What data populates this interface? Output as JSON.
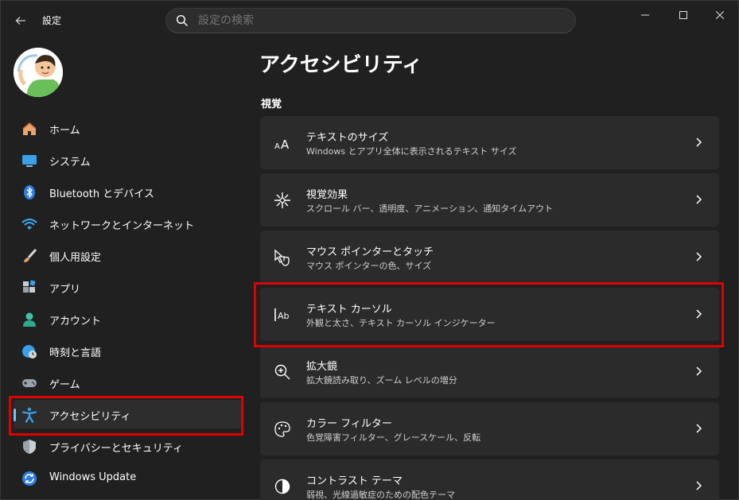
{
  "app": {
    "title": "設定"
  },
  "search": {
    "placeholder": "設定の検索"
  },
  "sidebar": {
    "items": [
      {
        "label": "ホーム",
        "icon": "home-icon"
      },
      {
        "label": "システム",
        "icon": "monitor-icon"
      },
      {
        "label": "Bluetooth とデバイス",
        "icon": "bluetooth-icon"
      },
      {
        "label": "ネットワークとインターネット",
        "icon": "wifi-icon"
      },
      {
        "label": "個人用設定",
        "icon": "brush-icon"
      },
      {
        "label": "アプリ",
        "icon": "apps-icon"
      },
      {
        "label": "アカウント",
        "icon": "person-icon"
      },
      {
        "label": "時刻と言語",
        "icon": "clock-globe-icon"
      },
      {
        "label": "ゲーム",
        "icon": "gamepad-icon"
      },
      {
        "label": "アクセシビリティ",
        "icon": "accessibility-icon",
        "active": true
      },
      {
        "label": "プライバシーとセキュリティ",
        "icon": "shield-icon"
      },
      {
        "label": "Windows Update",
        "icon": "update-icon"
      }
    ]
  },
  "main": {
    "title": "アクセシビリティ",
    "section": "視覚",
    "cards": [
      {
        "title": "テキストのサイズ",
        "subtitle": "Windows とアプリ全体に表示されるテキスト サイズ",
        "icon": "text-size-icon"
      },
      {
        "title": "視覚効果",
        "subtitle": "スクロール バー、透明度、アニメーション、通知タイムアウト",
        "icon": "sparkle-icon"
      },
      {
        "title": "マウス ポインターとタッチ",
        "subtitle": "マウス ポインターの色、サイズ",
        "icon": "pointer-touch-icon"
      },
      {
        "title": "テキスト カーソル",
        "subtitle": "外観と太さ、テキスト カーソル インジケーター",
        "icon": "text-cursor-icon"
      },
      {
        "title": "拡大鏡",
        "subtitle": "拡大鏡読み取り、ズーム レベルの増分",
        "icon": "magnifier-icon"
      },
      {
        "title": "カラー フィルター",
        "subtitle": "色覚障害フィルター、グレースケール、反転",
        "icon": "palette-icon"
      },
      {
        "title": "コントラスト テーマ",
        "subtitle": "弱視、光線過敏症のための配色テーマ",
        "icon": "contrast-icon"
      }
    ]
  },
  "colors": {
    "accent": "#60cdff",
    "highlight": "#e00000",
    "card": "#2b2b2b",
    "background": "#202020"
  }
}
